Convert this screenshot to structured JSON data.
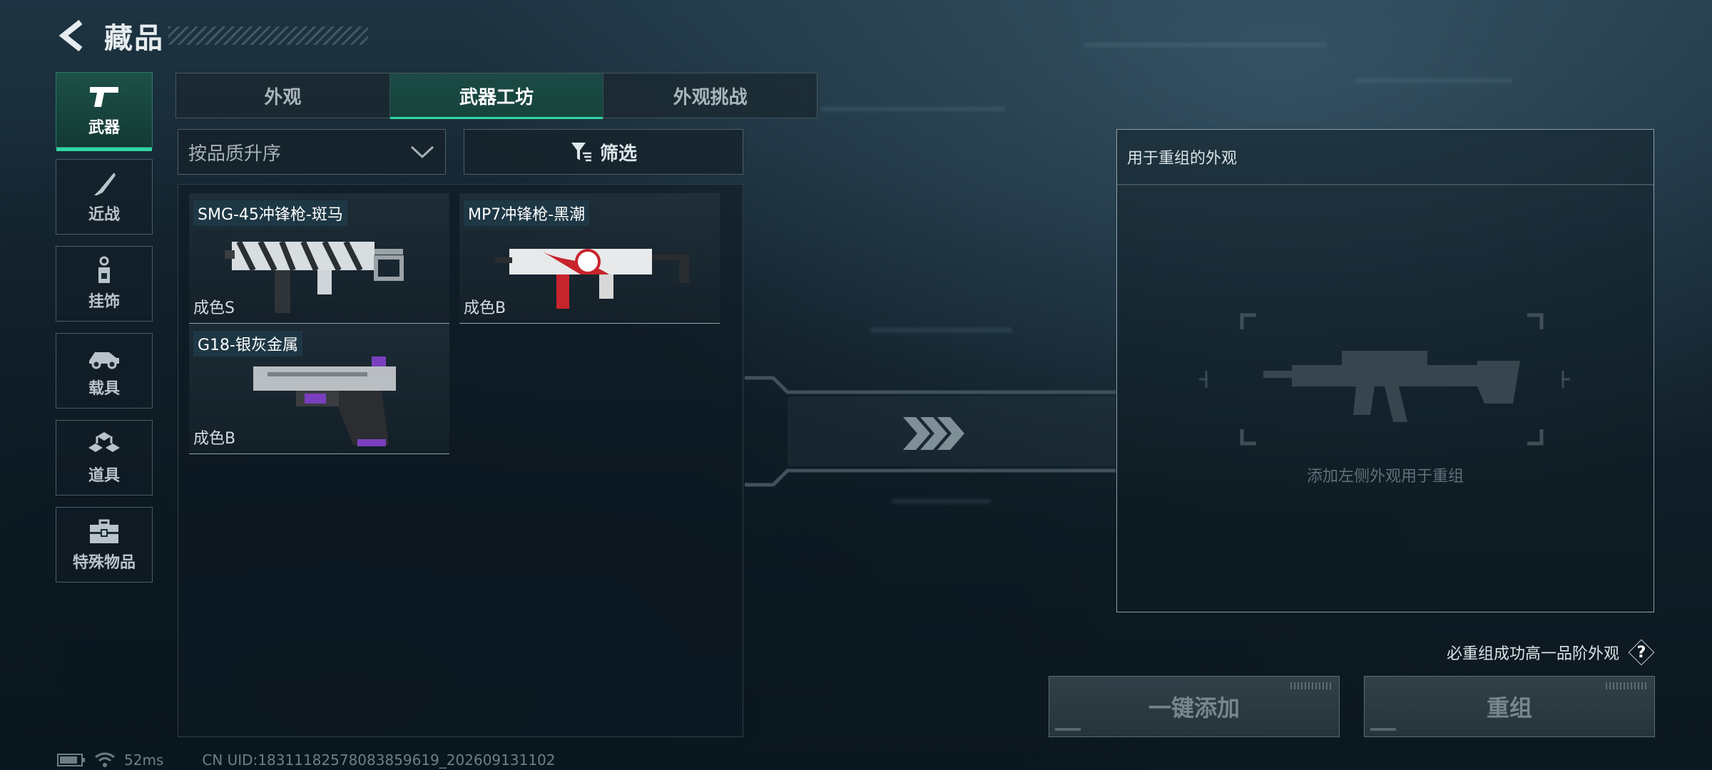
{
  "header": {
    "title": "藏品"
  },
  "sidebar": {
    "items": [
      {
        "label": "武器",
        "icon": "pistol-icon",
        "active": true
      },
      {
        "label": "近战",
        "icon": "knife-icon",
        "active": false
      },
      {
        "label": "挂饰",
        "icon": "charm-icon",
        "active": false
      },
      {
        "label": "载具",
        "icon": "vehicle-icon",
        "active": false
      },
      {
        "label": "道具",
        "icon": "items-icon",
        "active": false
      },
      {
        "label": "特殊物品",
        "icon": "toolbox-icon",
        "active": false
      }
    ]
  },
  "tabs": [
    {
      "label": "外观",
      "active": false
    },
    {
      "label": "武器工坊",
      "active": true
    },
    {
      "label": "外观挑战",
      "active": false
    }
  ],
  "sort": {
    "label": "按品质升序"
  },
  "filter": {
    "label": "筛选"
  },
  "items": [
    {
      "name": "SMG-45冲锋枪-斑马",
      "grade": "成色S"
    },
    {
      "name": "MP7冲锋枪-黑潮",
      "grade": "成色B"
    },
    {
      "name": "G18-银灰金属",
      "grade": "成色B"
    }
  ],
  "recompose": {
    "title": "用于重组的外观",
    "placeholder": "添加左侧外观用于重组"
  },
  "hint": {
    "text": "必重组成功高一品阶外观",
    "help": "?"
  },
  "buttons": {
    "add_all": "一键添加",
    "recompose": "重组"
  },
  "status": {
    "ping": "52ms",
    "uid": "CN UID:18311182578083859619_202609131102"
  },
  "colors": {
    "accent": "#2fd6a6",
    "tab_active_bg": "#1b4a45"
  }
}
